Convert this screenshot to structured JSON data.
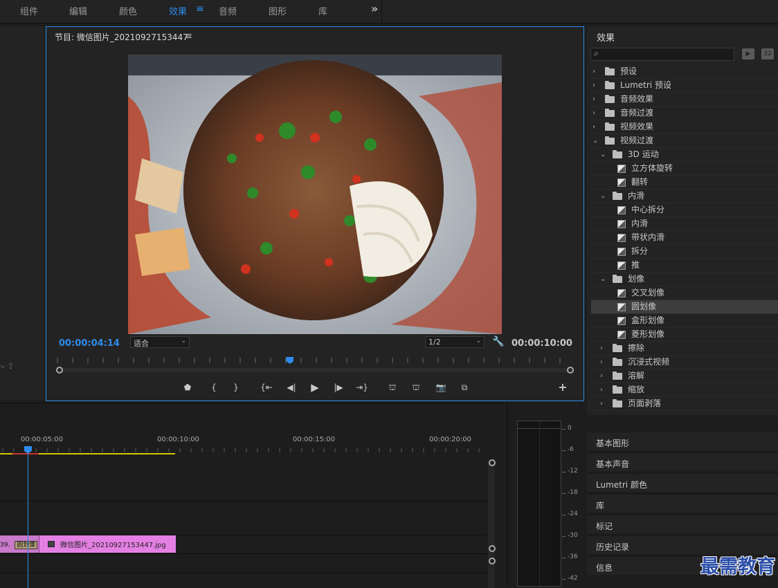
{
  "workspace_tabs": [
    {
      "label": "组件",
      "active": false
    },
    {
      "label": "编辑",
      "active": false
    },
    {
      "label": "颜色",
      "active": false
    },
    {
      "label": "效果",
      "active": true
    },
    {
      "label": "音频",
      "active": false
    },
    {
      "label": "图形",
      "active": false
    },
    {
      "label": "库",
      "active": false
    }
  ],
  "program_monitor": {
    "title": "节目: 微信图片_20210927153447",
    "current_timecode": "00:00:04:14",
    "duration_timecode": "00:00:10:00",
    "zoom_select": "适合",
    "resolution_select": "1/2",
    "playhead_fraction": 0.44
  },
  "effects_panel": {
    "title": "效果",
    "search_placeholder": "",
    "btn_accel": "▶",
    "btn_32": "32",
    "tree": [
      {
        "label": "预设",
        "level": 0,
        "type": "star-folder",
        "expanded": false
      },
      {
        "label": "Lumetri 预设",
        "level": 0,
        "type": "star-folder",
        "expanded": false
      },
      {
        "label": "音频效果",
        "level": 0,
        "type": "folder",
        "expanded": false
      },
      {
        "label": "音频过渡",
        "level": 0,
        "type": "folder",
        "expanded": false
      },
      {
        "label": "视频效果",
        "level": 0,
        "type": "folder",
        "expanded": false
      },
      {
        "label": "视频过渡",
        "level": 0,
        "type": "folder",
        "expanded": true
      },
      {
        "label": "3D 运动",
        "level": 1,
        "type": "folder",
        "expanded": true
      },
      {
        "label": "立方体旋转",
        "level": 2,
        "type": "effect"
      },
      {
        "label": "翻转",
        "level": 2,
        "type": "effect"
      },
      {
        "label": "内滑",
        "level": 1,
        "type": "folder",
        "expanded": true
      },
      {
        "label": "中心拆分",
        "level": 2,
        "type": "effect"
      },
      {
        "label": "内滑",
        "level": 2,
        "type": "effect"
      },
      {
        "label": "带状内滑",
        "level": 2,
        "type": "effect"
      },
      {
        "label": "拆分",
        "level": 2,
        "type": "effect"
      },
      {
        "label": "推",
        "level": 2,
        "type": "effect"
      },
      {
        "label": "划像",
        "level": 1,
        "type": "folder",
        "expanded": true
      },
      {
        "label": "交叉划像",
        "level": 2,
        "type": "effect"
      },
      {
        "label": "圆划像",
        "level": 2,
        "type": "effect",
        "selected": true
      },
      {
        "label": "盒形划像",
        "level": 2,
        "type": "effect"
      },
      {
        "label": "菱形划像",
        "level": 2,
        "type": "effect"
      },
      {
        "label": "擦除",
        "level": 1,
        "type": "folder",
        "expanded": false
      },
      {
        "label": "沉浸式视频",
        "level": 1,
        "type": "folder",
        "expanded": false
      },
      {
        "label": "溶解",
        "level": 1,
        "type": "folder",
        "expanded": false
      },
      {
        "label": "缩放",
        "level": 1,
        "type": "folder",
        "expanded": false
      },
      {
        "label": "页面剥落",
        "level": 1,
        "type": "folder",
        "expanded": false
      }
    ]
  },
  "stacked_panels": [
    "基本图形",
    "基本声音",
    "Lumetri 颜色",
    "库",
    "标记",
    "历史记录",
    "信息"
  ],
  "timeline": {
    "ruler_labels": [
      "00:00:05:00",
      "00:00:10:00",
      "00:00:15:00",
      "00:00:20:00"
    ],
    "clip_a_label": "39.",
    "clip_a_tag": "圆划像",
    "clip_b_label": "微信图片_20210927153447.jpg"
  },
  "meter_labels": [
    "0",
    "-6",
    "-12",
    "-18",
    "-24",
    "-30",
    "-36",
    "-42"
  ],
  "watermark": "最需教育",
  "colors": {
    "accent": "#2d8ceb",
    "clip": "#e480e4",
    "workarea": "#d8c700"
  }
}
